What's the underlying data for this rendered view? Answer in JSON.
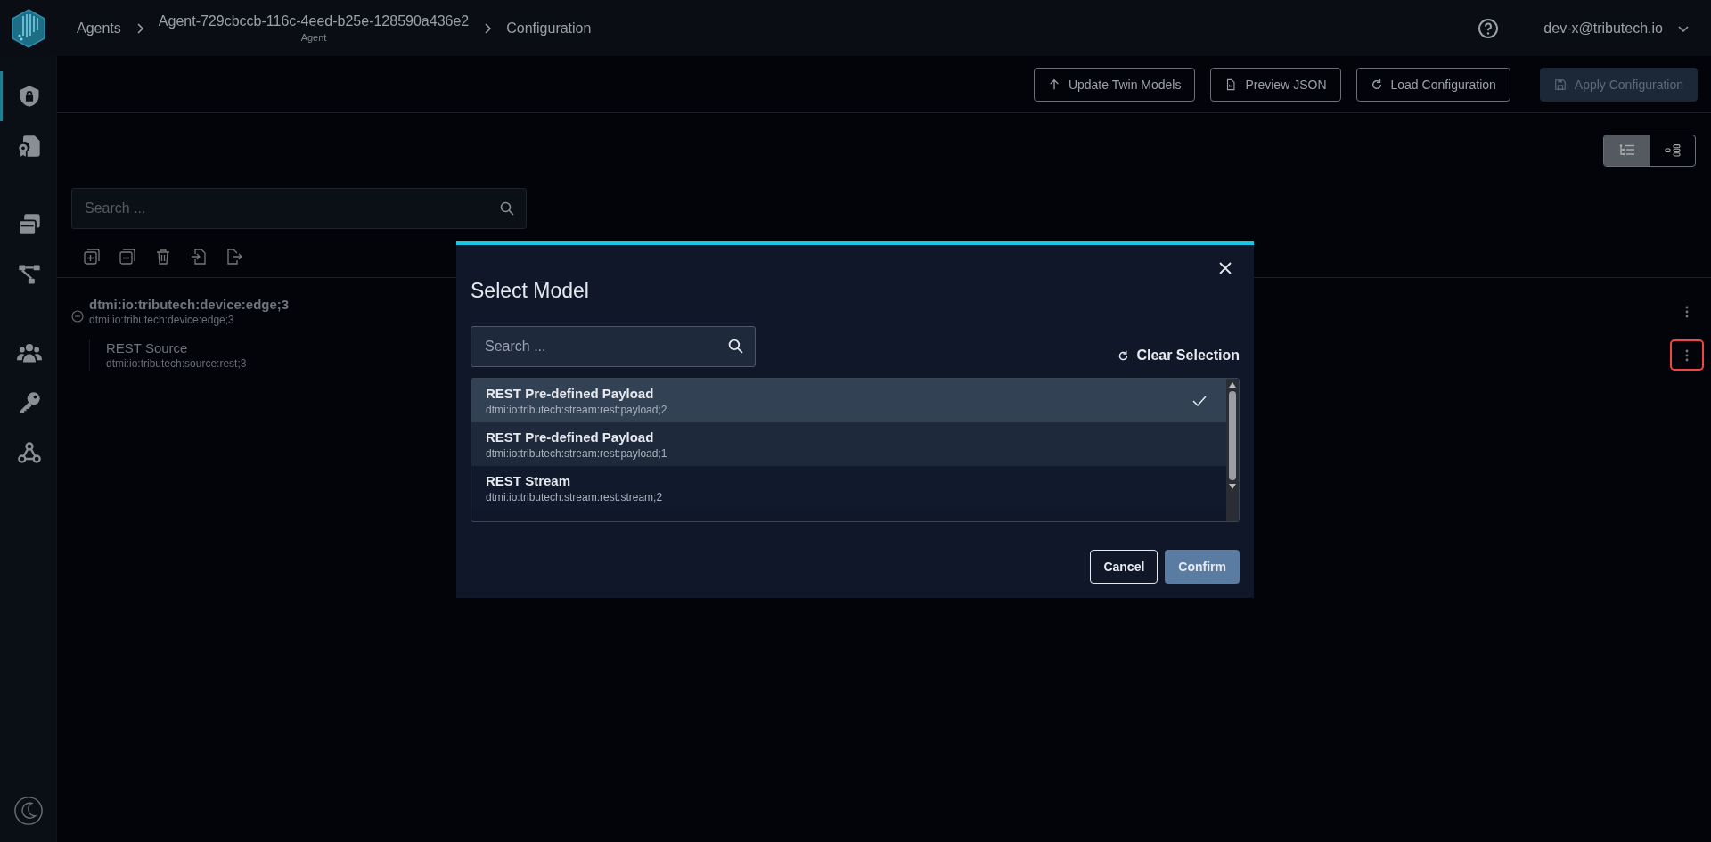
{
  "header": {
    "breadcrumbs": [
      {
        "label": "Agents"
      },
      {
        "label": "Agent-729cbccb-116c-4eed-b25e-128590a436e2",
        "caption": "Agent"
      },
      {
        "label": "Configuration"
      }
    ],
    "user": "dev-x@tributech.io"
  },
  "sidebar": {
    "items": [
      {
        "kind": "shield",
        "selected": true
      },
      {
        "kind": "certificate",
        "selected": false
      },
      {
        "kind": "cards",
        "selected": false
      },
      {
        "kind": "network",
        "selected": false
      },
      {
        "kind": "users",
        "selected": false
      },
      {
        "kind": "key",
        "selected": false
      },
      {
        "kind": "webhook",
        "selected": false
      }
    ]
  },
  "toolbar": {
    "buttons": [
      {
        "label": "Update Twin Models",
        "disabled": false
      },
      {
        "label": "Preview JSON",
        "disabled": false
      },
      {
        "label": "Load Configuration",
        "disabled": false
      },
      {
        "label": "Apply Configuration",
        "disabled": true
      }
    ]
  },
  "view_toggle": [
    {
      "kind": "list",
      "selected": true
    },
    {
      "kind": "tree",
      "selected": false
    }
  ],
  "search": {
    "placeholder": "Search ..."
  },
  "tree": [
    {
      "title": "dtmi:io:tributech:device:edge;3",
      "subtitle": "dtmi:io:tributech:device:edge;3",
      "expanded": true,
      "menu_highlighted": false,
      "children": [
        {
          "title": "REST Source",
          "subtitle": "dtmi:io:tributech:source:rest;3",
          "menu_highlighted": true
        }
      ]
    }
  ],
  "dialog": {
    "title": "Select Model",
    "search": {
      "placeholder": "Search ..."
    },
    "clear_label": "Clear Selection",
    "models": [
      {
        "name": "REST Pre-defined Payload",
        "id": "dtmi:io:tributech:stream:rest:payload;2",
        "selected": true
      },
      {
        "name": "REST Pre-defined Payload",
        "id": "dtmi:io:tributech:stream:rest:payload;1",
        "selected": false
      },
      {
        "name": "REST Stream",
        "id": "dtmi:io:tributech:stream:rest:stream;2",
        "selected": false
      }
    ],
    "cancel_label": "Cancel",
    "confirm_label": "Confirm"
  }
}
